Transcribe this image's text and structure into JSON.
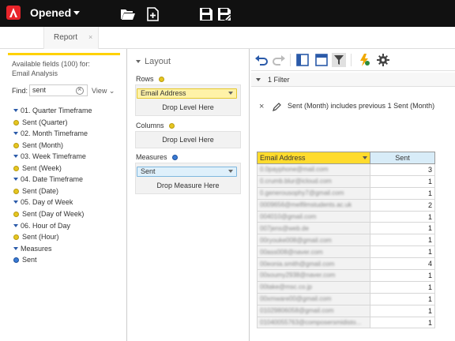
{
  "app": {
    "title": "Opened"
  },
  "tabs": [
    {
      "label": "Report",
      "close": "×"
    }
  ],
  "fields_panel": {
    "available_line1": "Available fields (100) for:",
    "available_line2": "Email Analysis",
    "find_label": "Find:",
    "find_value": "sent",
    "view_label": "View",
    "tree": [
      {
        "type": "folder",
        "label": "01. Quarter Timeframe"
      },
      {
        "type": "field",
        "label": "Sent (Quarter)"
      },
      {
        "type": "folder",
        "label": "02. Month Timeframe"
      },
      {
        "type": "field",
        "label": "Sent (Month)"
      },
      {
        "type": "folder",
        "label": "03. Week Timeframe"
      },
      {
        "type": "field",
        "label": "Sent (Week)"
      },
      {
        "type": "folder",
        "label": "04. Date Timeframe"
      },
      {
        "type": "field",
        "label": "Sent (Date)"
      },
      {
        "type": "folder",
        "label": "05. Day of Week"
      },
      {
        "type": "field",
        "label": "Sent (Day of Week)"
      },
      {
        "type": "folder",
        "label": "06. Hour of Day"
      },
      {
        "type": "field",
        "label": "Sent (Hour)"
      },
      {
        "type": "folder",
        "label": "Measures"
      },
      {
        "type": "measure",
        "label": "Sent"
      }
    ]
  },
  "layout_panel": {
    "title": "Layout",
    "rows_label": "Rows",
    "rows_pill": "Email Address",
    "rows_drop": "Drop Level Here",
    "columns_label": "Columns",
    "columns_drop": "Drop Level Here",
    "measures_label": "Measures",
    "measures_pill": "Sent",
    "measures_drop": "Drop Measure Here"
  },
  "view_panel": {
    "filter_count": "1 Filter",
    "filter_text": "Sent (Month) includes previous 1 Sent (Month)",
    "grid": {
      "headers": [
        "Email Address",
        "Sent"
      ],
      "rows": [
        {
          "email": "0.0payphone@mail.com",
          "sent": "3"
        },
        {
          "email": "0.crumb.blur@icloud.com",
          "sent": "1"
        },
        {
          "email": "0.generousophy7@gmail.com",
          "sent": "1"
        },
        {
          "email": "0009656@melfilmstudents.ac.uk",
          "sent": "2"
        },
        {
          "email": "004010@gmail.com",
          "sent": "1"
        },
        {
          "email": "007jens@web.de",
          "sent": "1"
        },
        {
          "email": "00ryouke008@gmail.com",
          "sent": "1"
        },
        {
          "email": "00ass008@naver.com",
          "sent": "1"
        },
        {
          "email": "00eonia.smith@gmail.com",
          "sent": "4"
        },
        {
          "email": "00soumy2938@naver.com",
          "sent": "1"
        },
        {
          "email": "00take@msc.co.jp",
          "sent": "1"
        },
        {
          "email": "00xmware00@gmail.com",
          "sent": "1"
        },
        {
          "email": "01029806058@gmail.com",
          "sent": "1"
        },
        {
          "email": "01040055763@composersmidisto...",
          "sent": "1"
        }
      ]
    }
  },
  "colors": {
    "topbar": "#111111",
    "brand_red": "#e8242a",
    "accent_yellow": "#ffd200",
    "header_yellow": "#ffdb2d",
    "header_blue": "#d8ecf8"
  }
}
